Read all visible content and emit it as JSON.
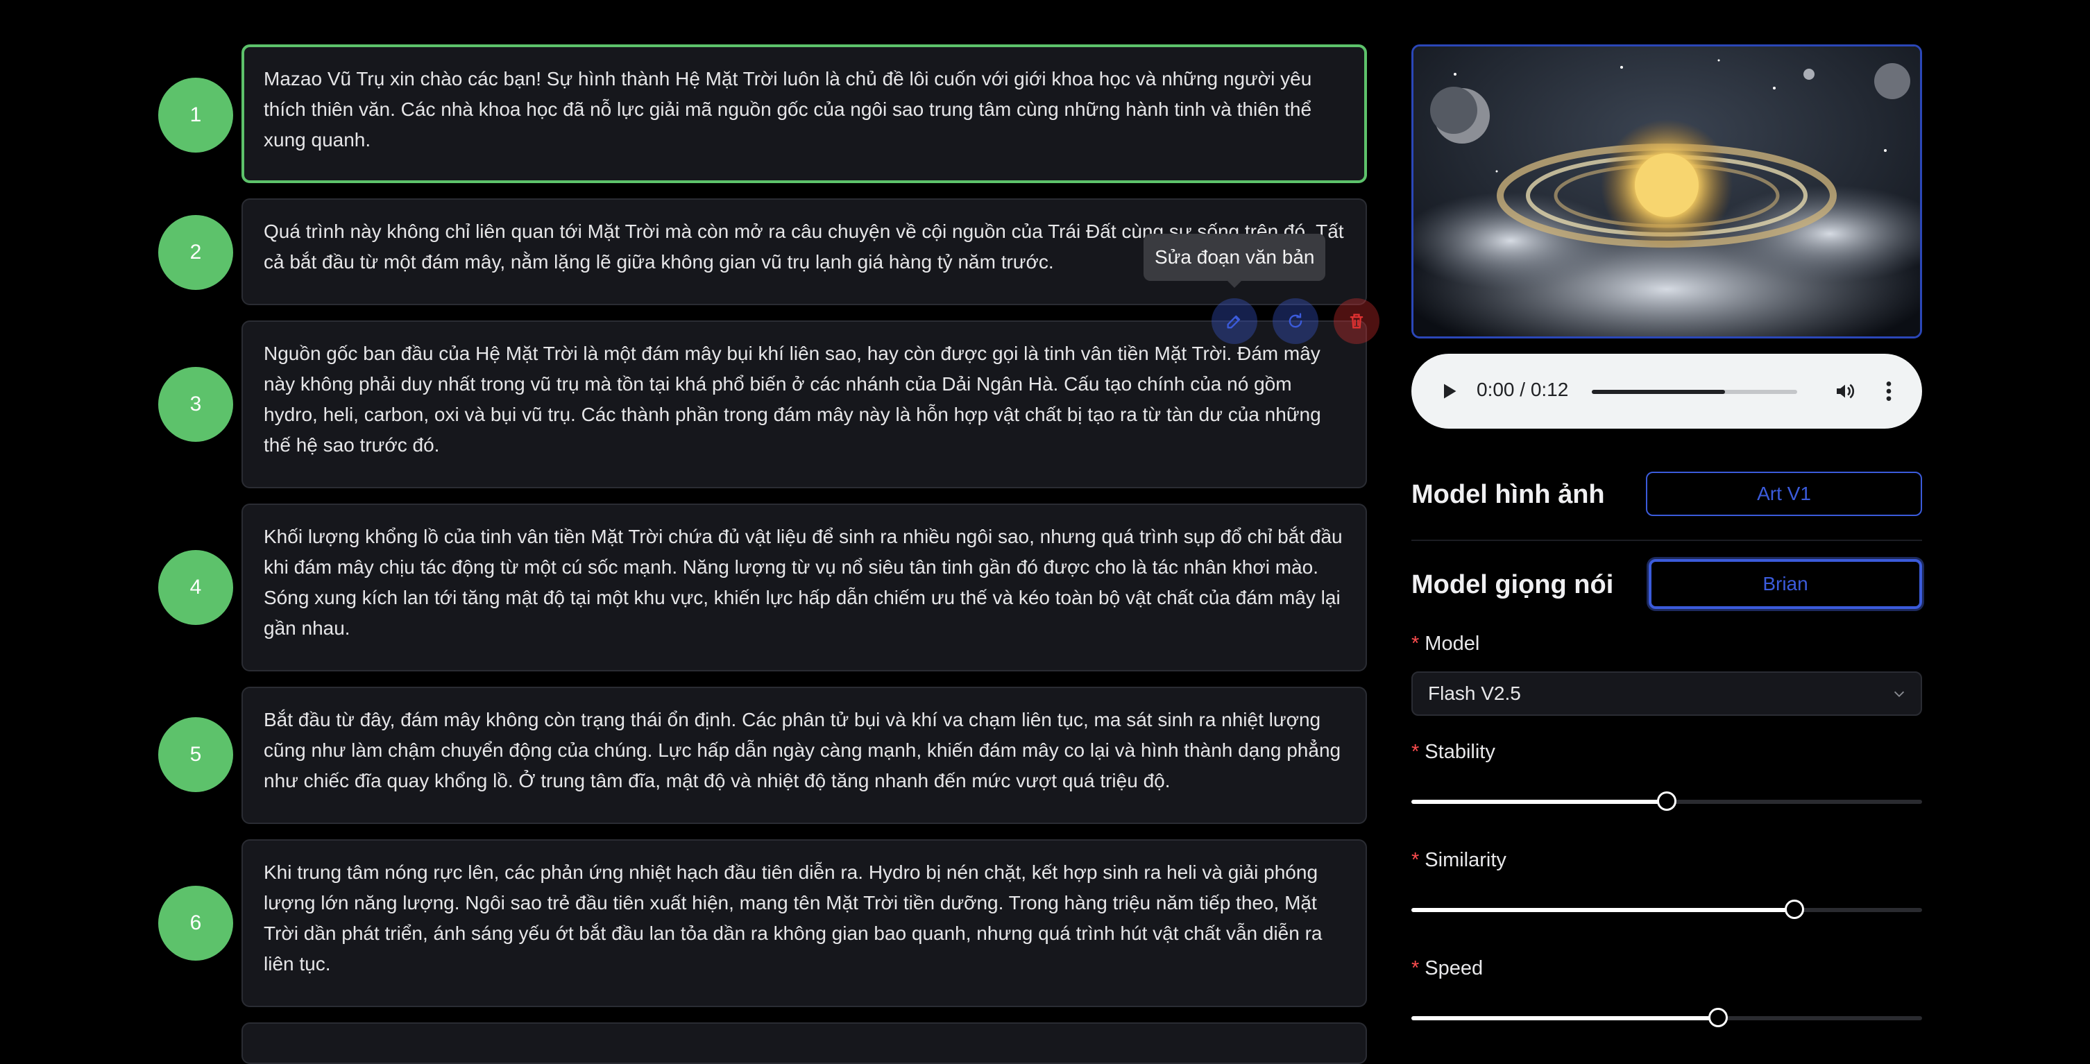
{
  "segments": [
    {
      "number": "1",
      "text": "Mazao Vũ Trụ xin chào các bạn! Sự hình thành Hệ Mặt Trời luôn là chủ đề lôi cuốn với giới khoa học và những người yêu thích thiên văn. Các nhà khoa học đã nỗ lực giải mã nguồn gốc của ngôi sao trung tâm cùng những hành tinh và thiên thể xung quanh."
    },
    {
      "number": "2",
      "text": "Quá trình này không chỉ liên quan tới Mặt Trời mà còn mở ra câu chuyện về cội nguồn của Trái Đất cùng sự sống trên đó. Tất cả bắt đầu từ một đám mây, nằm lặng lẽ giữa không gian vũ trụ lạnh giá hàng tỷ năm trước."
    },
    {
      "number": "3",
      "text": "Nguồn gốc ban đầu của Hệ Mặt Trời là một đám mây bụi khí liên sao, hay còn được gọi là tinh vân tiền Mặt Trời. Đám mây này không phải duy nhất trong vũ trụ mà tồn tại khá phổ biến ở các nhánh của Dải Ngân Hà. Cấu tạo chính của nó gồm hydro, heli, carbon, oxi và bụi vũ trụ. Các thành phần trong đám mây này là hỗn hợp vật chất bị tạo ra từ tàn dư của những thế hệ sao trước đó."
    },
    {
      "number": "4",
      "text": "Khối lượng khổng lồ của tinh vân tiền Mặt Trời chứa đủ vật liệu để sinh ra nhiều ngôi sao, nhưng quá trình sụp đổ chỉ bắt đầu khi đám mây chịu tác động từ một cú sốc mạnh. Năng lượng từ vụ nổ siêu tân tinh gần đó được cho là tác nhân khơi mào. Sóng xung kích lan tới tăng mật độ tại một khu vực, khiến lực hấp dẫn chiếm ưu thế và kéo toàn bộ vật chất của đám mây lại gần nhau."
    },
    {
      "number": "5",
      "text": "Bắt đầu từ đây, đám mây không còn trạng thái ổn định. Các phân tử bụi và khí va chạm liên tục, ma sát sinh ra nhiệt lượng cũng như làm chậm chuyển động của chúng. Lực hấp dẫn ngày càng mạnh, khiến đám mây co lại và hình thành dạng phẳng như chiếc đĩa quay khổng lồ. Ở trung tâm đĩa, mật độ và nhiệt độ tăng nhanh đến mức vượt quá triệu độ."
    },
    {
      "number": "6",
      "text": "Khi trung tâm nóng rực lên, các phản ứng nhiệt hạch đầu tiên diễn ra. Hydro bị nén chặt, kết hợp sinh ra heli và giải phóng lượng lớn năng lượng. Ngôi sao trẻ đầu tiên xuất hiện, mang tên Mặt Trời tiền dưỡng. Trong hàng triệu năm tiếp theo, Mặt Trời dần phát triển, ánh sáng yếu ớt bắt đầu lan tỏa dần ra không gian bao quanh, nhưng quá trình hút vật chất vẫn diễn ra liên tục."
    }
  ],
  "tooltip": "Sửa đoạn văn bản",
  "segment_actions": [
    {
      "icon": "edit-icon",
      "color": "#3b5bdb"
    },
    {
      "icon": "refresh-icon",
      "color": "#3b5bdb"
    },
    {
      "icon": "trash-icon",
      "color": "#e03131"
    }
  ],
  "audio": {
    "time": "0:00 / 0:12",
    "progress_percent": 65
  },
  "image_model": {
    "label": "Model hình ảnh",
    "value": "Art V1"
  },
  "voice_model": {
    "label": "Model giọng nói",
    "value": "Brian"
  },
  "form": {
    "model_label": "Model",
    "model_value": "Flash V2.5",
    "stability_label": "Stability",
    "stability_value": 0.5,
    "similarity_label": "Similarity",
    "similarity_value": 0.75,
    "speed_label": "Speed",
    "speed_value": 0.6
  },
  "colors": {
    "accent": "#5dc26b",
    "primary": "#3b5bdb",
    "danger": "#e03131",
    "required": "#ff4d4f"
  }
}
